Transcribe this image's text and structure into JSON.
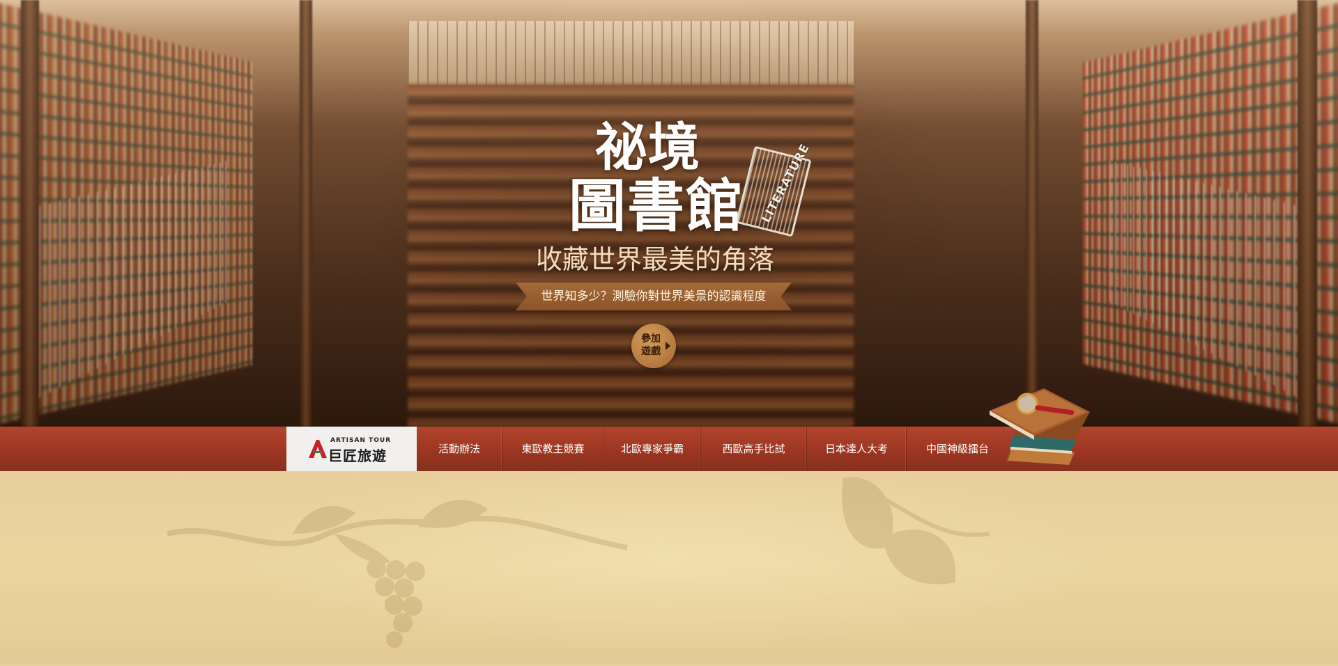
{
  "hero": {
    "title_line1": "祕境",
    "title_line2": "圖書館",
    "stamp_text": "LITERATURE",
    "subtitle": "收藏世界最美的角落",
    "ribbon_text": "世界知多少？測驗你對世界美景的認識程度",
    "play_button_label": "參加遊戲"
  },
  "brand": {
    "logo_en": "ARTISAN TOUR",
    "logo_zh": "巨匠旅遊"
  },
  "nav": {
    "items": [
      {
        "label": "活動辦法"
      },
      {
        "label": "東歐教主競賽"
      },
      {
        "label": "北歐專家爭霸"
      },
      {
        "label": "西歐高手比試"
      },
      {
        "label": "日本達人大考"
      },
      {
        "label": "中國神級擂台"
      }
    ]
  },
  "colors": {
    "navbar": "#9c3622",
    "parchment": "#e6cf9c",
    "ribbon": "#9a5f30",
    "play_button": "#c08648"
  },
  "icons": {
    "play_arrow": "play-icon",
    "books_illustration": "books-magnifier-icon",
    "logo_mark": "artisan-logo-icon"
  }
}
